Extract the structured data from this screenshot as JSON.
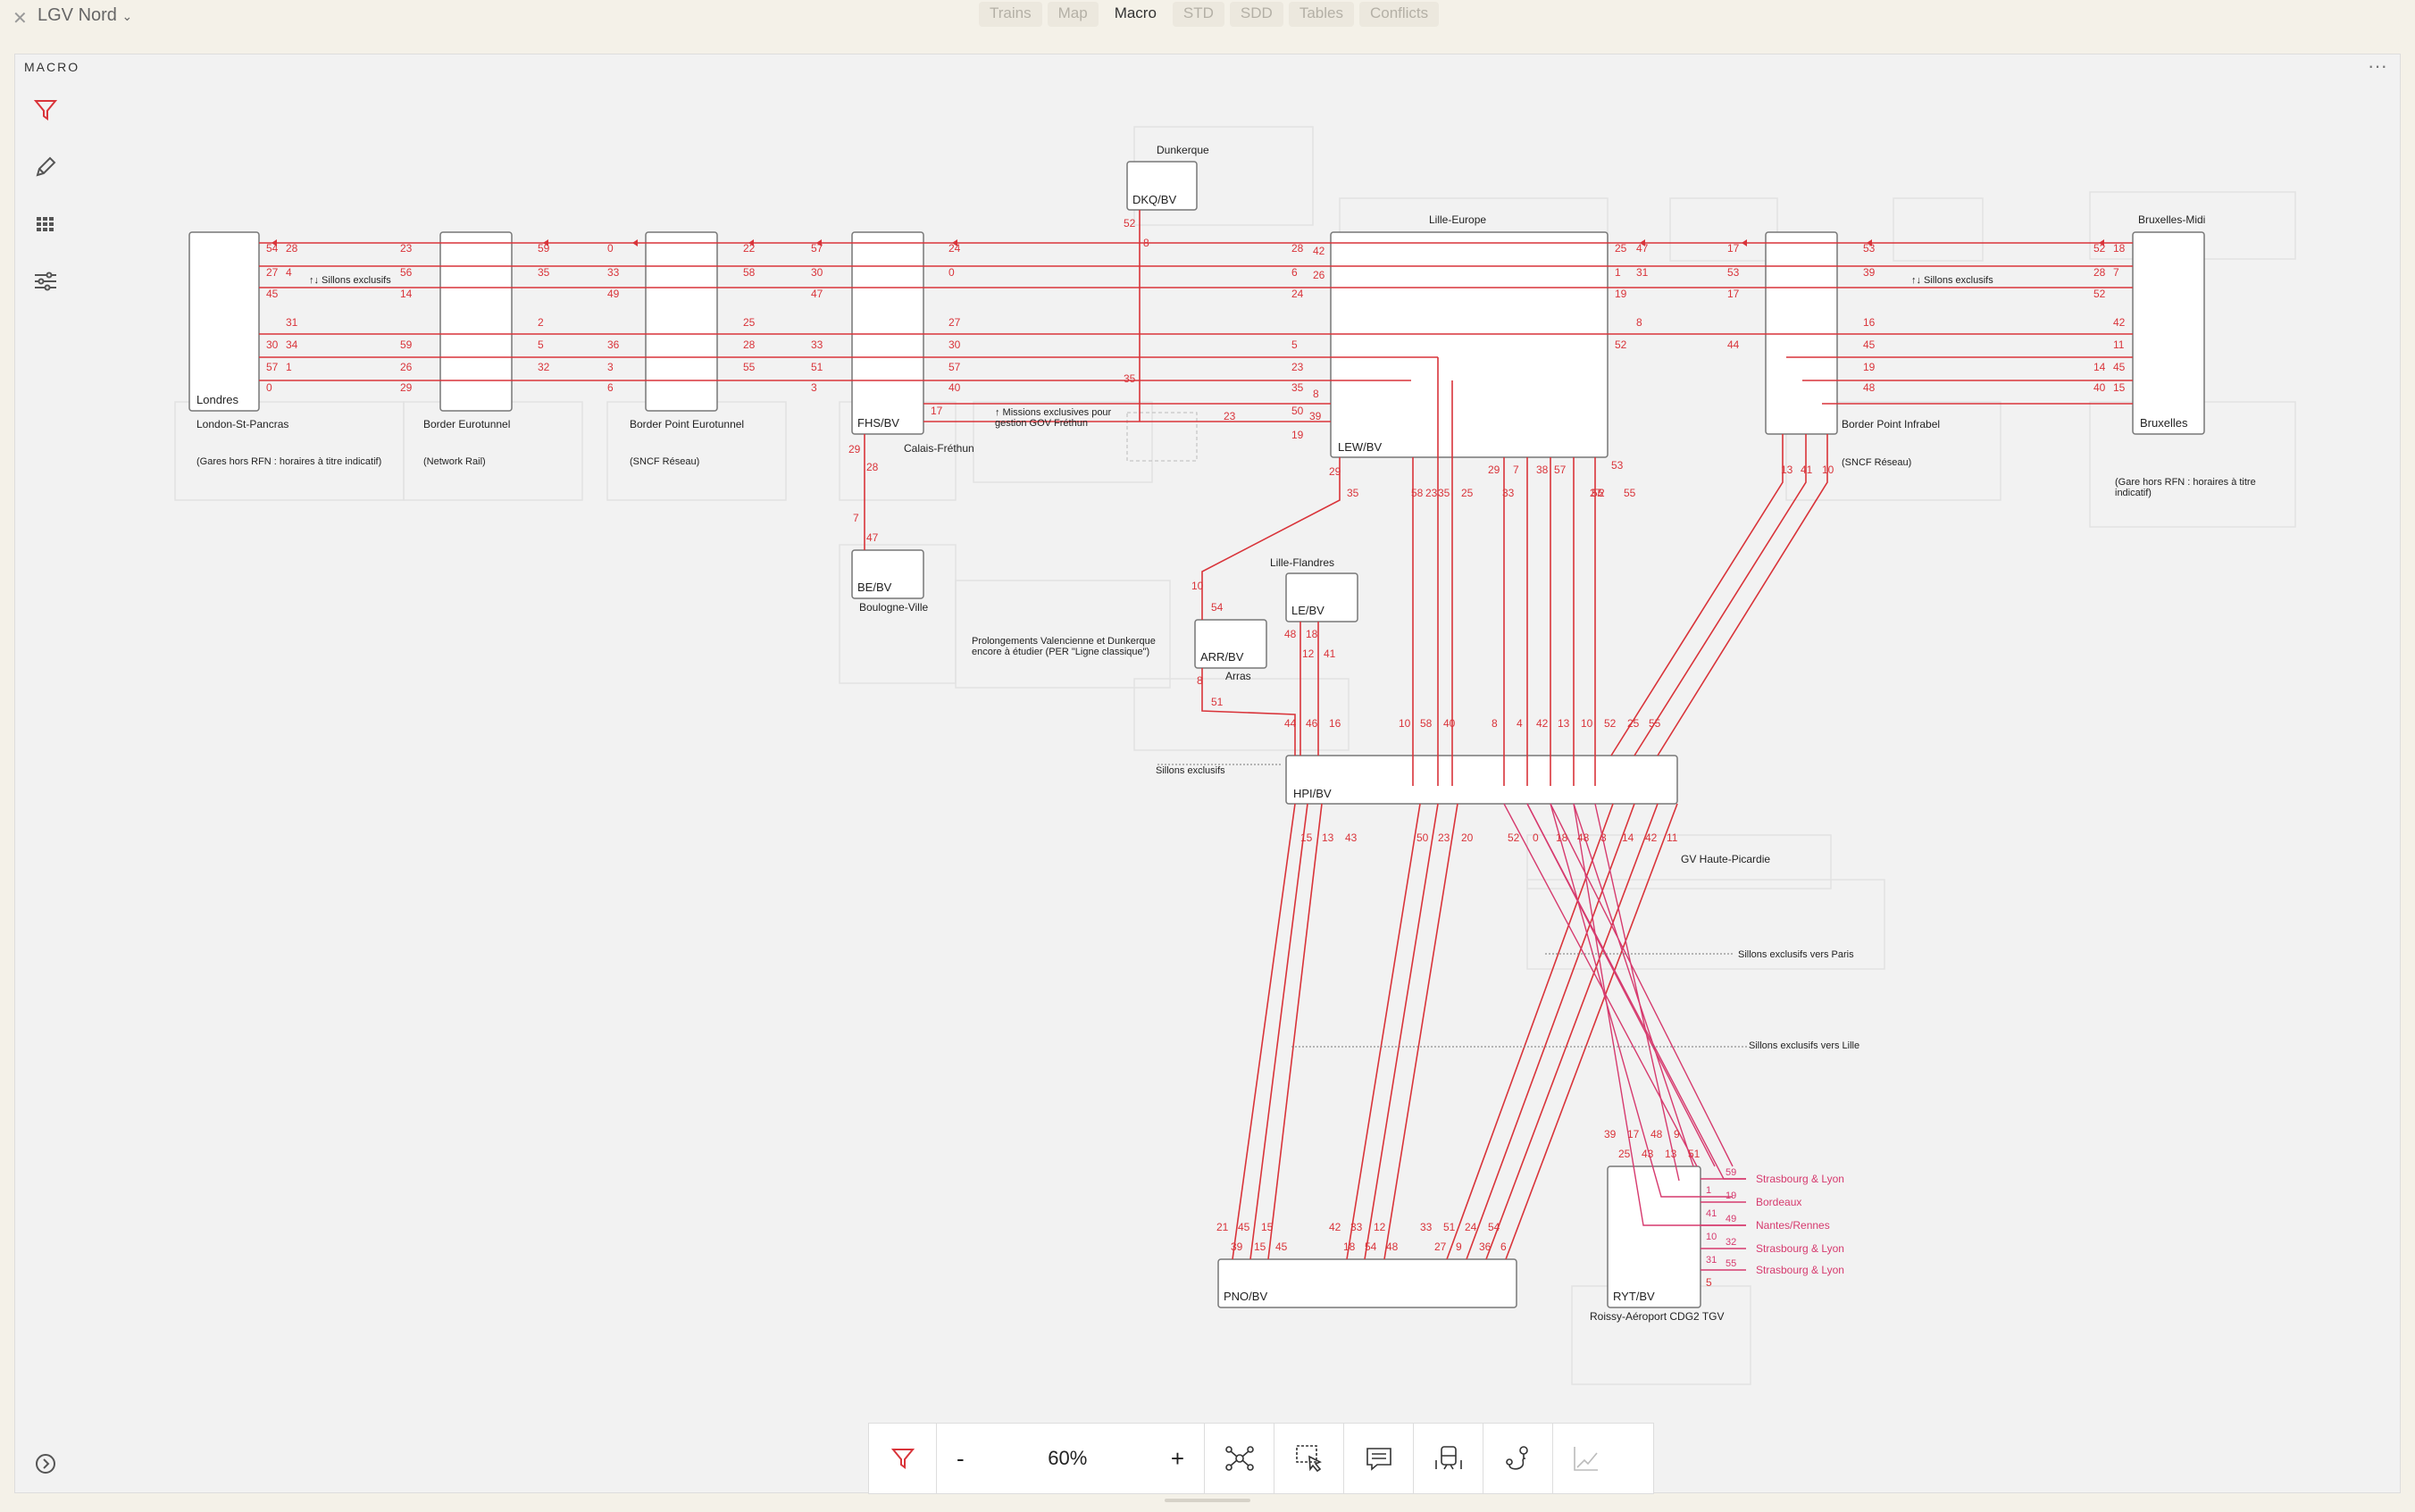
{
  "app": {
    "project": "LGV Nord",
    "close_icon": "close-icon",
    "chevron": "chevron-down-icon"
  },
  "tabs": [
    {
      "label": "Trains"
    },
    {
      "label": "Map"
    },
    {
      "label": "Macro",
      "active": true
    },
    {
      "label": "STD"
    },
    {
      "label": "SDD"
    },
    {
      "label": "Tables"
    },
    {
      "label": "Conflicts"
    }
  ],
  "panel": {
    "title": "MACRO",
    "more": "···"
  },
  "sidebar": {
    "tools": [
      "filter-icon",
      "pencil-icon",
      "grid-icon",
      "sliders-icon"
    ],
    "expand": "chevron-right-icon"
  },
  "toolbar": {
    "minus": "-",
    "zoom": "60%",
    "plus": "+",
    "tools": [
      "filter-icon",
      "network-icon",
      "select-icon",
      "comment-icon",
      "train-icon",
      "route-icon",
      "chart-icon"
    ]
  },
  "colors": {
    "accent": "#d9343a",
    "pink": "#d63a6e",
    "node_border": "#777"
  },
  "nodes": {
    "londres": "Londres",
    "bruxelles": "Bruxelles",
    "dkq": "DKQ/BV",
    "lew": "LEW/BV",
    "fhs": "FHS/BV",
    "be": "BE/BV",
    "arr": "ARR/BV",
    "le": "LE/BV",
    "hpi": "HPI/BV",
    "pno": "PNO/BV",
    "ryt": "RYT/BV"
  },
  "labels": {
    "dunkerque": "Dunkerque",
    "lille_europe": "Lille-Europe",
    "bruxelles_midi": "Bruxelles-Midi",
    "london": "London-St-Pancras",
    "london_note": "(Gares hors RFN : horaires à titre indicatif)",
    "border_eurotunnel": "Border Eurotunnel",
    "network_rail": "(Network Rail)",
    "border_point_eurotunnel": "Border Point Eurotunnel",
    "sncf_reseau": "(SNCF Réseau)",
    "calais": "Calais-Fréthun",
    "missions": "↑ Missions exclusives pour gestion GOV Fréthun",
    "boulogne": "Boulogne-Ville",
    "prolong": "Prolongements Valencienne et Dunkerque encore à étudier (PER \"Ligne classique\")",
    "lille_flandres": "Lille-Flandres",
    "arras": "Arras",
    "sillons_excl": "Sillons exclusifs",
    "sillons_excl_left": "↑↓ Sillons exclusifs",
    "sillons_excl_right": "↑↓ Sillons exclusifs",
    "border_point_infrabel": "Border Point Infrabel",
    "sncf_reseau2": "(SNCF Réseau)",
    "bxl_note": "(Gare hors RFN : horaires à titre indicatif)",
    "gv_hp": "GV Haute-Picardie",
    "sil_paris": "Sillons exclusifs vers Paris",
    "sil_lille": "Sillons exclusifs vers Lille",
    "roissy": "Roissy-Aéroport CDG2 TGV"
  },
  "destinations": [
    {
      "label": "Strasbourg & Lyon",
      "n1": "59",
      "n2": ""
    },
    {
      "label": "Bordeaux",
      "n1": "1",
      "n2": "19"
    },
    {
      "label": "Nantes/Rennes",
      "n1": "41",
      "n2": "49"
    },
    {
      "label": "Strasbourg & Lyon",
      "n1": "10",
      "n2": "32"
    },
    {
      "label": "Strasbourg & Lyon",
      "n1": "31",
      "n2": "55"
    }
  ],
  "numbers": {
    "lon_a": [
      "54",
      "27",
      "45",
      "",
      "30",
      "57",
      "0"
    ],
    "lon_b": [
      "28",
      "4",
      "",
      "31",
      "34",
      "1",
      ""
    ],
    "be_l": [
      "23",
      "56",
      "14",
      "",
      "59",
      "26",
      "29"
    ],
    "be_r": [
      "59",
      "35",
      "",
      "2",
      "5",
      "32",
      ""
    ],
    "bpe_l": [
      "0",
      "33",
      "49",
      "",
      "36",
      "3",
      "6"
    ],
    "bpe_r": [
      "22",
      "58",
      "",
      "25",
      "28",
      "55",
      ""
    ],
    "fhs_l": [
      "57",
      "30",
      "47",
      "",
      "33",
      "51",
      "3"
    ],
    "fhs_r": [
      "24",
      "0",
      "",
      "27",
      "30",
      "57",
      "40"
    ],
    "lew_l": [
      "28",
      "6",
      "24",
      "",
      "5",
      "23",
      "35"
    ],
    "lew_in": [
      "42",
      "26",
      "",
      "",
      "",
      "",
      "8",
      "39",
      "19"
    ],
    "lew_r": [
      "25",
      "1",
      "19",
      "",
      "52",
      "",
      ""
    ],
    "lew_rr": [
      "47",
      "31",
      "",
      "8",
      "",
      "",
      ""
    ],
    "bpi_l": [
      "17",
      "53",
      "17",
      "",
      "44",
      "",
      ""
    ],
    "bpi_r": [
      "53",
      "39",
      "",
      "16",
      "45",
      "19",
      "48"
    ],
    "bx_l": [
      "52",
      "28",
      "52",
      "",
      "",
      "14",
      "40"
    ],
    "bx_r": [
      "18",
      "7",
      "",
      "42",
      "11",
      "45",
      "15"
    ],
    "bx_r2": [
      "",
      "",
      "",
      "18",
      "44",
      ""
    ],
    "misc": [
      "52",
      "8",
      "35",
      "17",
      "23",
      "50",
      "29",
      "28",
      "7",
      "47",
      "29",
      "35",
      "10",
      "54",
      "8",
      "51",
      "48",
      "18",
      "12",
      "41",
      "13",
      "41",
      "10",
      "2",
      "55",
      "53",
      "27",
      "33",
      "29",
      "7",
      "38",
      "57",
      "23",
      "35",
      "25",
      "58",
      "55"
    ],
    "hpi_top": [
      "44",
      "46",
      "16",
      "10",
      "58",
      "40",
      "8",
      "4",
      "42",
      "13",
      "10",
      "52",
      "25",
      "55"
    ],
    "hpi_bot": [
      "15",
      "13",
      "43",
      "50",
      "23",
      "20",
      "52",
      "0",
      "18",
      "48",
      "3",
      "14",
      "42",
      "11"
    ],
    "pno_top": [
      "21",
      "45",
      "15",
      "42",
      "33",
      "12",
      "33",
      "51",
      "24",
      "54"
    ],
    "pno_bot": [
      "39",
      "15",
      "45",
      "18",
      "54",
      "48",
      "27",
      "9",
      "36",
      "6"
    ],
    "ryt_top": [
      "39",
      "17",
      "48",
      "9",
      "25",
      "43",
      "13",
      "51"
    ],
    "ryt_side": [
      "1",
      "41",
      "10",
      "31",
      "5"
    ]
  }
}
